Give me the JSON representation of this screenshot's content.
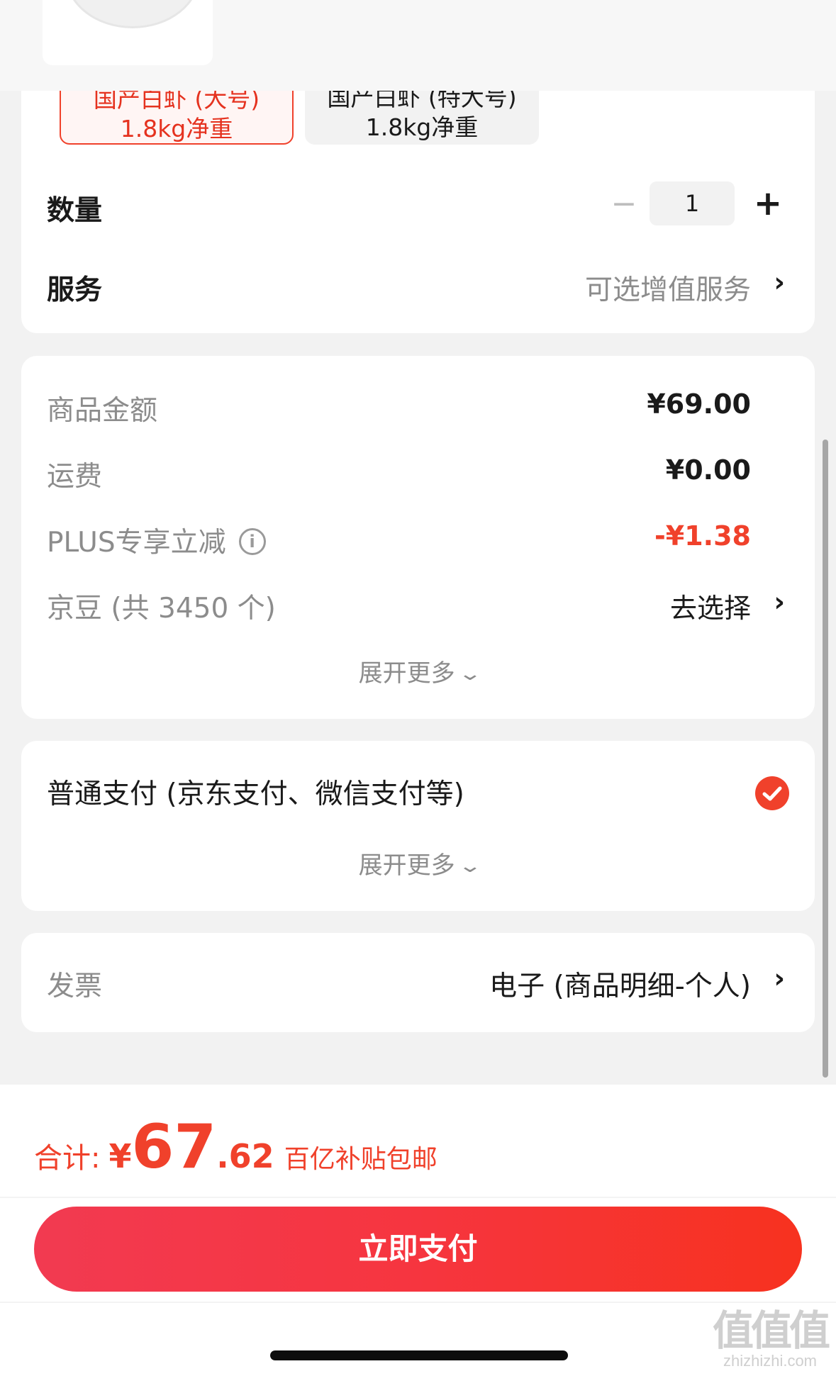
{
  "product": {
    "specs": [
      {
        "title": "国产白虾 (大号)",
        "sub": "1.8kg净重",
        "selected": true
      },
      {
        "title": "国产白虾 (特大号)",
        "sub": "1.8kg净重",
        "selected": false
      }
    ],
    "quantity_label": "数量",
    "quantity_value": "1",
    "minus_symbol": "−",
    "plus_symbol": "+",
    "service_label": "服务",
    "service_value": "可选增值服务"
  },
  "price": {
    "rows": [
      {
        "label": "商品金额",
        "value": "¥69.00"
      },
      {
        "label": "运费",
        "value": "¥0.00"
      },
      {
        "label": "PLUS专享立减",
        "value": "-¥1.38"
      },
      {
        "label": "京豆 (共 3450 个)",
        "value": "去选择"
      }
    ],
    "expand_label": "展开更多"
  },
  "payment": {
    "method": "普通支付 (京东支付、微信支付等)",
    "expand_label": "展开更多"
  },
  "invoice": {
    "label": "发票",
    "value": "电子 (商品明细-个人)"
  },
  "footer": {
    "total_label": "合计:",
    "currency": "¥",
    "total_int": "67",
    "total_dec": ".62",
    "note": "百亿补贴包邮",
    "pay_button": "立即支付"
  },
  "watermark": {
    "logo": "值值值",
    "text": "zhizhizhi.com"
  },
  "colors": {
    "accent": "#f0412b",
    "background": "#f2f2f2",
    "muted_text": "#8c8c8c"
  }
}
